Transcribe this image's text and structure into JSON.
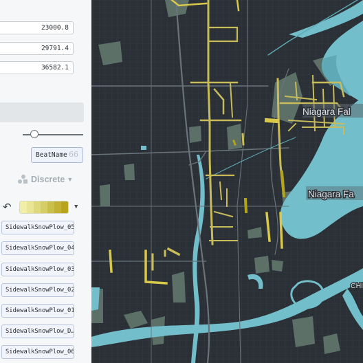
{
  "panel": {
    "range_values": [
      "23000.8",
      "29791.4",
      "36582.1"
    ],
    "field_name": "BeatName",
    "quote_glyph": "66",
    "scale_mode": "Discrete",
    "undo_glyph": "↶",
    "caret_glyph": "▼",
    "ramp_colors": [
      "#f1efa7",
      "#e9e594",
      "#dfd97d",
      "#d5cd66",
      "#cbbf4c",
      "#c2b133",
      "#b8a41c"
    ],
    "legend_items": [
      "SidewalkSnowPlow_05",
      "SidewalkSnowPlow_04",
      "SidewalkSnowPlow_03",
      "SidewalkSnowPlow_02",
      "SidewalkSnowPlow_01",
      "SidewalkSnowPlow_D…",
      "SidewalkSnowPlow_06"
    ]
  },
  "map": {
    "labels": [
      "Niagara Fal",
      "Niagara Fa",
      "CHI"
    ],
    "colors": {
      "background": "#2a3036",
      "water": "#72bfcb",
      "water_dark": "#5fa9b6",
      "park": "#5c7068",
      "street": "#3b434b",
      "highway": "#69737b",
      "route": "#c8bb5a",
      "route_bright": "#d9c94a"
    }
  }
}
